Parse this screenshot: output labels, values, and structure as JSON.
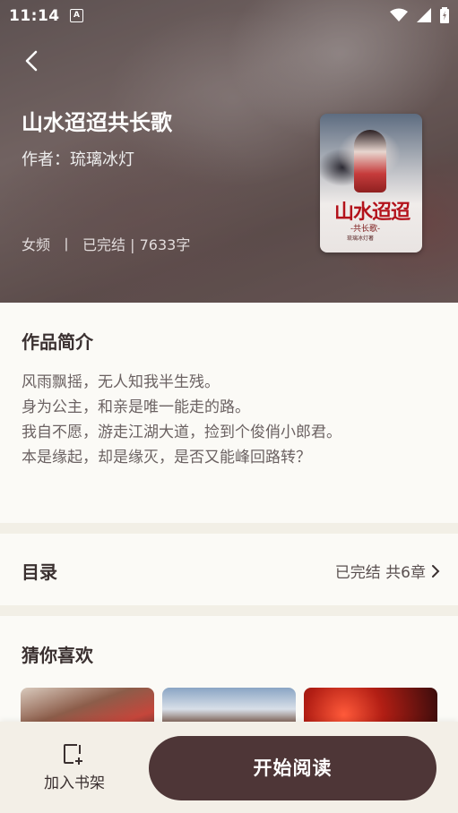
{
  "status_bar": {
    "time": "11:14",
    "notification_icon": "A"
  },
  "book": {
    "title": "山水迢迢共长歌",
    "author_label": "作者：",
    "author": "琉璃冰灯",
    "category": "女频",
    "separator": "丨",
    "status": "已完结 | 7633字",
    "cover_title": "山水迢迢",
    "cover_subtitle": "-共长歌-",
    "cover_small": "琉璃冰灯著"
  },
  "intro": {
    "title": "作品简介",
    "lines": [
      "风雨飘摇，无人知我半生残。",
      "身为公主，和亲是唯一能走的路。",
      "我自不愿，游走江湖大道，捡到个俊俏小郎君。",
      "本是缘起，却是缘灭，是否又能峰回路转？"
    ]
  },
  "toc": {
    "title": "目录",
    "status": "已完结 共6章"
  },
  "recommend": {
    "title": "猜你喜欢"
  },
  "actions": {
    "add_shelf": "加入书架",
    "start_reading": "开始阅读"
  },
  "colors": {
    "primary_button": "#4e3637",
    "background": "#fbfaf6",
    "divider": "#f2efe6"
  }
}
